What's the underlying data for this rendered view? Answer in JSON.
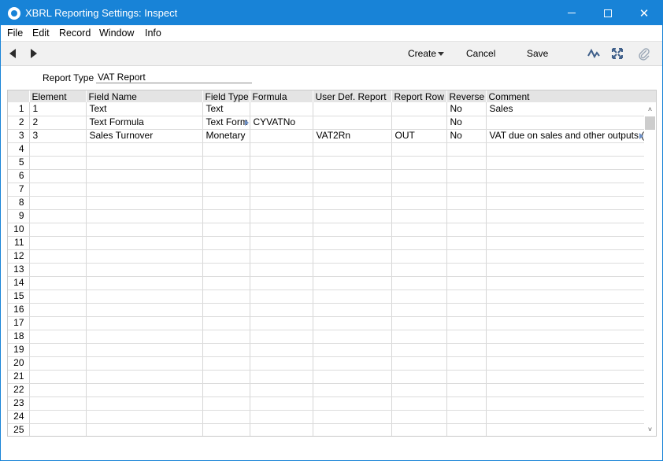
{
  "window": {
    "title": "XBRL Reporting Settings: Inspect",
    "controls": {
      "minimize": "minimize-icon",
      "maximize": "maximize-icon",
      "close": "✕"
    }
  },
  "menu": [
    "File",
    "Edit",
    "Record",
    "Window",
    "Info"
  ],
  "toolbar": {
    "create_label": "Create",
    "cancel_label": "Cancel",
    "save_label": "Save",
    "icons": [
      "back-arrow-icon",
      "forward-arrow-icon",
      "activity-icon",
      "expand-icon",
      "paperclip-icon"
    ]
  },
  "header": {
    "report_type_label": "Report Type",
    "report_type_value": "VAT Report"
  },
  "grid": {
    "columns": [
      "",
      "Element",
      "Field Name",
      "Field Type",
      "Formula",
      "User Def. Report",
      "Report Row",
      "Reverse",
      "Comment"
    ],
    "rows": [
      [
        "1",
        "1",
        "Text",
        "Text",
        "",
        "",
        "",
        "No",
        "Sales"
      ],
      [
        "2",
        "2",
        "Text Formula",
        "Text Form",
        "CYVATNo",
        "",
        "",
        "No",
        ""
      ],
      [
        "3",
        "3",
        "Sales Turnover",
        "Monetary",
        "",
        "VAT2Rn",
        "OUT",
        "No",
        "VAT due on sales and other outputs (bi"
      ],
      [
        "4",
        "",
        "",
        "",
        "",
        "",
        "",
        "",
        ""
      ],
      [
        "5",
        "",
        "",
        "",
        "",
        "",
        "",
        "",
        ""
      ],
      [
        "6",
        "",
        "",
        "",
        "",
        "",
        "",
        "",
        ""
      ],
      [
        "7",
        "",
        "",
        "",
        "",
        "",
        "",
        "",
        ""
      ],
      [
        "8",
        "",
        "",
        "",
        "",
        "",
        "",
        "",
        ""
      ],
      [
        "9",
        "",
        "",
        "",
        "",
        "",
        "",
        "",
        ""
      ],
      [
        "10",
        "",
        "",
        "",
        "",
        "",
        "",
        "",
        ""
      ],
      [
        "11",
        "",
        "",
        "",
        "",
        "",
        "",
        "",
        ""
      ],
      [
        "12",
        "",
        "",
        "",
        "",
        "",
        "",
        "",
        ""
      ],
      [
        "13",
        "",
        "",
        "",
        "",
        "",
        "",
        "",
        ""
      ],
      [
        "14",
        "",
        "",
        "",
        "",
        "",
        "",
        "",
        ""
      ],
      [
        "15",
        "",
        "",
        "",
        "",
        "",
        "",
        "",
        ""
      ],
      [
        "16",
        "",
        "",
        "",
        "",
        "",
        "",
        "",
        ""
      ],
      [
        "17",
        "",
        "",
        "",
        "",
        "",
        "",
        "",
        ""
      ],
      [
        "18",
        "",
        "",
        "",
        "",
        "",
        "",
        "",
        ""
      ],
      [
        "19",
        "",
        "",
        "",
        "",
        "",
        "",
        "",
        ""
      ],
      [
        "20",
        "",
        "",
        "",
        "",
        "",
        "",
        "",
        ""
      ],
      [
        "21",
        "",
        "",
        "",
        "",
        "",
        "",
        "",
        ""
      ],
      [
        "22",
        "",
        "",
        "",
        "",
        "",
        "",
        "",
        ""
      ],
      [
        "23",
        "",
        "",
        "",
        "",
        "",
        "",
        "",
        ""
      ],
      [
        "24",
        "",
        "",
        "",
        "",
        "",
        "",
        "",
        ""
      ],
      [
        "25",
        "",
        "",
        "",
        "",
        "",
        "",
        "",
        ""
      ]
    ]
  },
  "colors": {
    "titlebar": "#1883d7",
    "toolbar": "#f1f1f1",
    "grid_header": "#e4e4e4"
  }
}
